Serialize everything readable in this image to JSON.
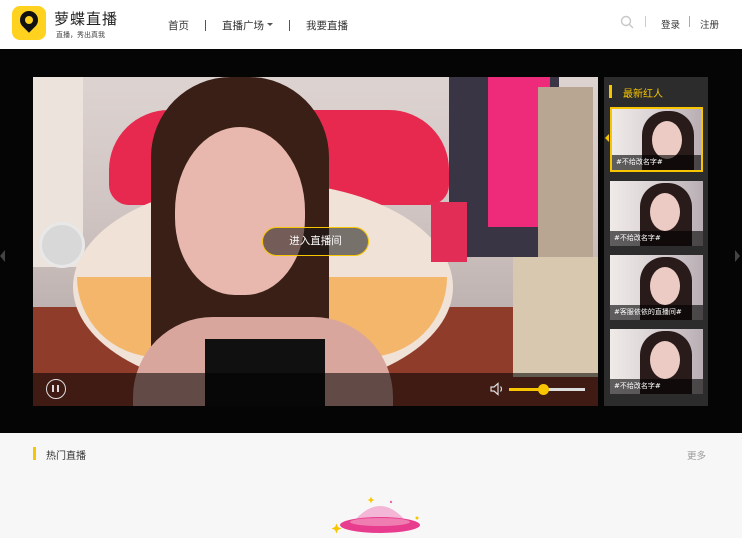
{
  "header": {
    "brand_name": "萝蝶直播",
    "brand_slogan": "直播，秀出真我",
    "nav": [
      {
        "label": "首页"
      },
      {
        "label": "直播广场"
      },
      {
        "label": "我要直播"
      }
    ],
    "login_label": "登录",
    "register_label": "注册"
  },
  "player": {
    "enter_button_label": "进入直播间",
    "volume_level_percent": 45
  },
  "latest": {
    "title": "最新红人",
    "items": [
      {
        "caption": "#不给改名字#",
        "active": true
      },
      {
        "caption": "#不给改名字#",
        "active": false
      },
      {
        "caption": "#客服依依的直播间#",
        "active": false
      },
      {
        "caption": "#不给改名字#",
        "active": false
      }
    ]
  },
  "hot": {
    "title": "热门直播",
    "more_label": "更多"
  },
  "colors": {
    "accent": "#f7c600",
    "stage_bg": "#050505",
    "panel_bg": "#2c2c2c"
  },
  "icons": [
    "logo-icon",
    "search-icon",
    "pause-icon",
    "volume-icon",
    "ufo-icon"
  ]
}
